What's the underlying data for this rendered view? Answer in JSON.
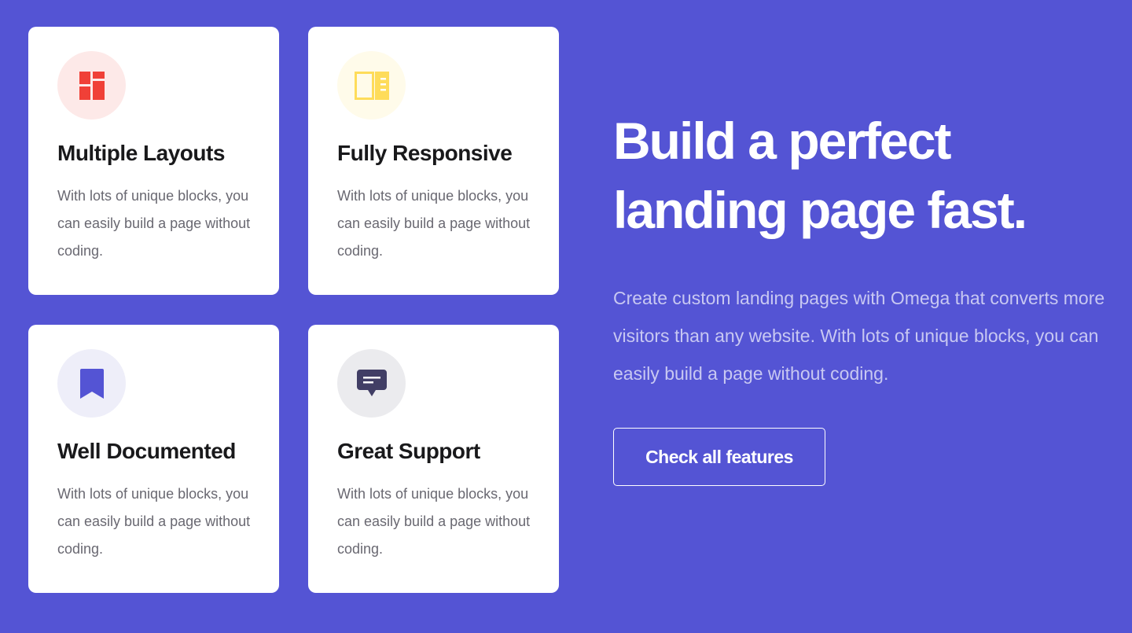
{
  "features": [
    {
      "icon": "layout-grid-icon",
      "title": "Multiple Layouts",
      "description": "With lots of unique blocks, you can easily build a page without coding.",
      "icon_color": "#f04037",
      "icon_bg": "#fde9e8"
    },
    {
      "icon": "responsive-panel-icon",
      "title": "Fully Responsive",
      "description": "With lots of unique blocks, you can easily build a page without coding.",
      "icon_color": "#fedc5a",
      "icon_bg": "#fffbea"
    },
    {
      "icon": "bookmark-icon",
      "title": "Well Documented",
      "description": "With lots of unique blocks, you can easily build a page without coding.",
      "icon_color": "#5454d4",
      "icon_bg": "#eeeef9"
    },
    {
      "icon": "chat-message-icon",
      "title": "Great Support",
      "description": "With lots of unique blocks, you can easily build a page without coding.",
      "icon_color": "#413e65",
      "icon_bg": "#ebebee"
    }
  ],
  "hero": {
    "title": "Build a perfect landing page fast.",
    "text": "Create custom landing pages with Omega that converts more visitors than any website. With lots of unique blocks, you can easily build a page without coding.",
    "button_label": "Check all features"
  },
  "colors": {
    "background": "#5454d4",
    "card": "#ffffff",
    "heading": "#19191b",
    "body_text": "#696871"
  }
}
